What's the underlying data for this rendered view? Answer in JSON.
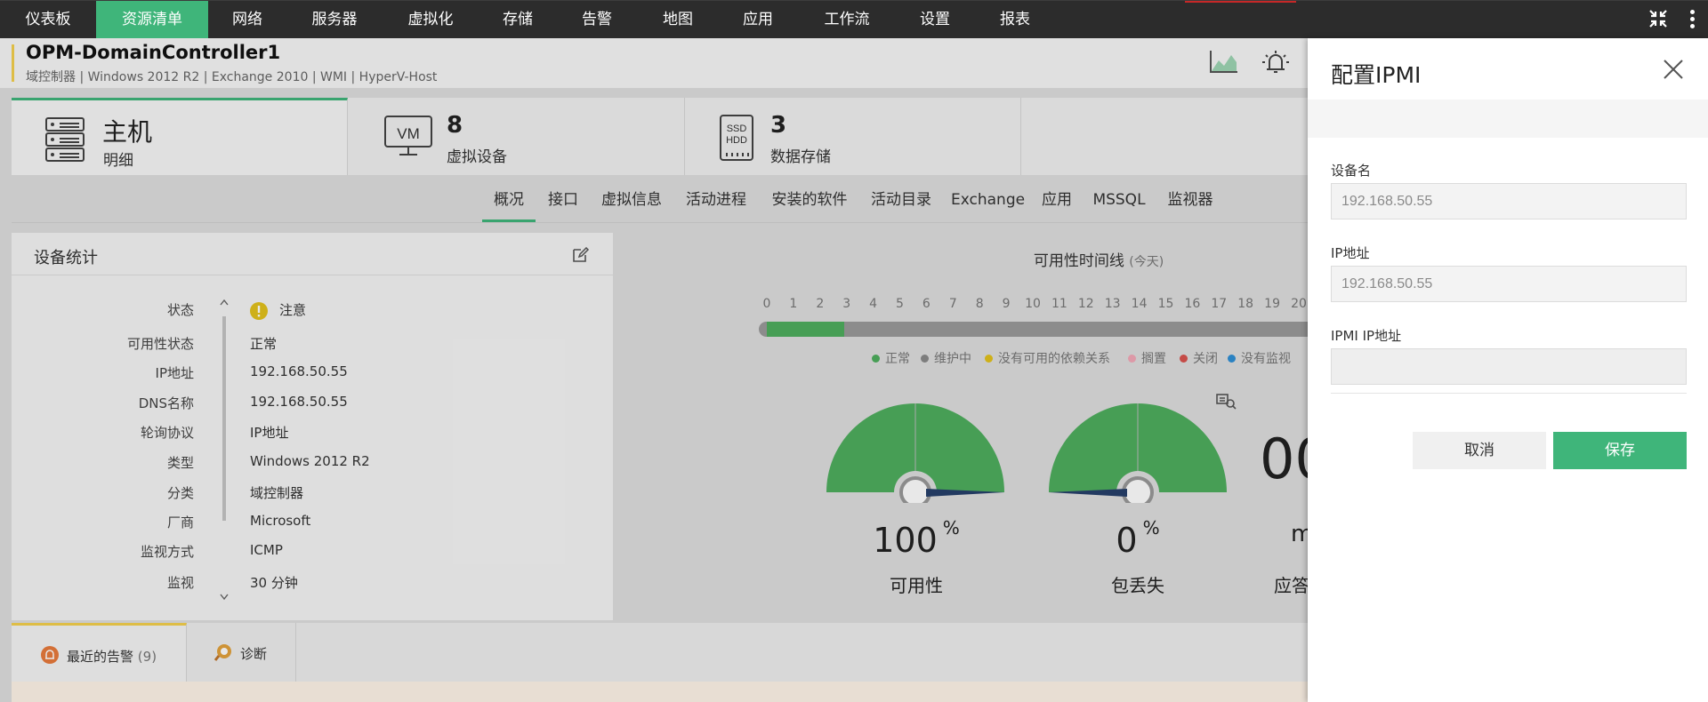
{
  "nav": {
    "items": [
      "仪表板",
      "资源清单",
      "网络",
      "服务器",
      "虚拟化",
      "存储",
      "告警",
      "地图",
      "应用",
      "工作流",
      "设置",
      "报表"
    ],
    "active_index": 1
  },
  "header": {
    "device_name": "OPM-DomainController1",
    "subtitle": "域控制器 | Windows 2012 R2 | Exchange 2010 | WMI | HyperV-Host"
  },
  "tiles": [
    {
      "title": "主机",
      "sub": "明细",
      "icon": "server-rack-icon"
    },
    {
      "title": "8",
      "sub": "虚拟设备",
      "icon": "vm-monitor-icon",
      "icon_text": "VM"
    },
    {
      "title": "3",
      "sub": "数据存储",
      "icon": "storage-drive-icon",
      "icon_text_1": "SSD",
      "icon_text_2": "HDD"
    }
  ],
  "subtabs": [
    "概况",
    "接口",
    "虚拟信息",
    "活动进程",
    "安装的软件",
    "活动目录",
    "Exchange",
    "应用",
    "MSSQL",
    "监视器"
  ],
  "device_stats": {
    "title": "设备统计",
    "rows": [
      {
        "label": "状态",
        "value": "注意"
      },
      {
        "label": "可用性状态",
        "value": "正常"
      },
      {
        "label": "IP地址",
        "value": "192.168.50.55"
      },
      {
        "label": "DNS名称",
        "value": "192.168.50.55"
      },
      {
        "label": "轮询协议",
        "value": "IP地址"
      },
      {
        "label": "类型",
        "value": "Windows 2012 R2"
      },
      {
        "label": "分类",
        "value": "域控制器"
      },
      {
        "label": "厂商",
        "value": "Microsoft"
      },
      {
        "label": "监视方式",
        "value": "ICMP"
      },
      {
        "label": "监视",
        "value": "30 分钟"
      }
    ]
  },
  "timeline": {
    "title": "可用性时间线",
    "suffix": "(今天)",
    "hours": [
      "0",
      "1",
      "2",
      "3",
      "4",
      "5",
      "6",
      "7",
      "8",
      "9",
      "10",
      "11",
      "12",
      "13",
      "14",
      "15",
      "16",
      "17",
      "18",
      "19",
      "20"
    ],
    "legend": [
      {
        "label": "正常",
        "color": "#4fae5e"
      },
      {
        "label": "维护中",
        "color": "#8a8a8a"
      },
      {
        "label": "没有可用的依赖关系",
        "color": "#e3c21c"
      },
      {
        "label": "搁置",
        "color": "#f3a9b8"
      },
      {
        "label": "关闭",
        "color": "#d9534f"
      },
      {
        "label": "没有监视",
        "color": "#2f8fd6"
      }
    ]
  },
  "gauges": [
    {
      "value": "100",
      "unit": "%",
      "label": "可用性",
      "level": 100
    },
    {
      "value": "0",
      "unit": "%",
      "label": "包丢失",
      "level": 0
    },
    {
      "value": "00",
      "unit": "m",
      "label": "应答"
    }
  ],
  "bottom_tabs": [
    {
      "label": "最近的告警",
      "count": "(9)"
    },
    {
      "label": "诊断"
    }
  ],
  "drawer": {
    "title": "配置IPMI",
    "fields": [
      {
        "label": "设备名",
        "value": "192.168.50.55"
      },
      {
        "label": "IP地址",
        "value": "192.168.50.55"
      },
      {
        "label": "IPMI IP地址",
        "value": ""
      }
    ],
    "cancel": "取消",
    "save": "保存"
  },
  "colors": {
    "accent": "#3fb57a",
    "nav_bg": "#2c2c2c",
    "attention": "#e3c21c"
  }
}
